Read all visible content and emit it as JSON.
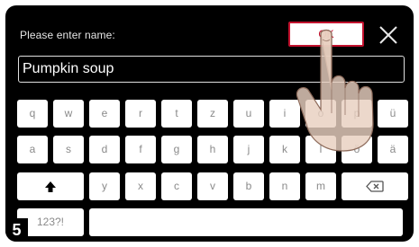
{
  "dialog": {
    "prompt": "Please enter name:",
    "ok_label": "OK",
    "close_icon": "close-icon",
    "input_value": "Pumpkin soup"
  },
  "keyboard": {
    "row1": [
      "q",
      "w",
      "e",
      "r",
      "t",
      "z",
      "u",
      "i",
      "o",
      "p",
      "ü"
    ],
    "row2": [
      "a",
      "s",
      "d",
      "f",
      "g",
      "h",
      "j",
      "k",
      "l",
      "ö",
      "ä"
    ],
    "row3": [
      "y",
      "x",
      "c",
      "v",
      "b",
      "n",
      "m"
    ],
    "shift_icon": "shift-arrow-icon",
    "backspace_icon": "backspace-icon",
    "mode_label": "123?!"
  },
  "step_badge": "5",
  "overlay": {
    "hand_icon": "pointing-hand-icon"
  },
  "colors": {
    "screen_bg": "#000000",
    "key_bg": "#ffffff",
    "key_text": "#8a8a8a",
    "accent": "#c2122e"
  }
}
